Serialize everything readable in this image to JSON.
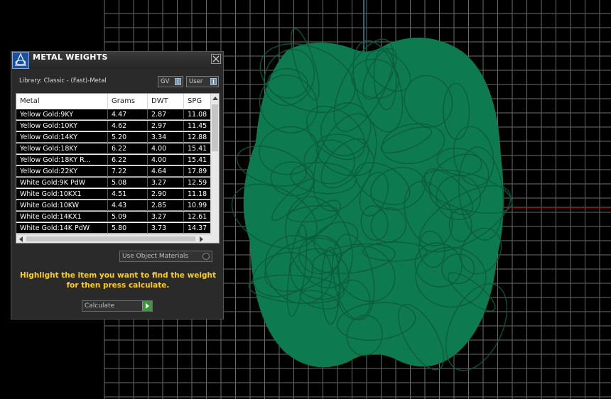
{
  "dialog": {
    "title": "METAL WEIGHTS",
    "library_label": "Library: Classic - (Fast)-Metal",
    "dropdown_gv": "GV",
    "dropdown_user": "User",
    "columns": [
      "Metal",
      "Grams",
      "DWT",
      "SPG"
    ],
    "rows": [
      {
        "metal": "Yellow Gold:9KY",
        "grams": "4.47",
        "dwt": "2.87",
        "spg": "11.08"
      },
      {
        "metal": "Yellow Gold:10KY",
        "grams": "4.62",
        "dwt": "2.97",
        "spg": "11.45"
      },
      {
        "metal": "Yellow Gold:14KY",
        "grams": "5.20",
        "dwt": "3.34",
        "spg": "12.88"
      },
      {
        "metal": "Yellow Gold:18KY",
        "grams": "6.22",
        "dwt": "4.00",
        "spg": "15.41"
      },
      {
        "metal": "Yellow Gold:18KY R...",
        "grams": "6.22",
        "dwt": "4.00",
        "spg": "15.41"
      },
      {
        "metal": "Yellow Gold:22KY",
        "grams": "7.22",
        "dwt": "4.64",
        "spg": "17.89"
      },
      {
        "metal": "White Gold:9K PdW",
        "grams": "5.08",
        "dwt": "3.27",
        "spg": "12.59"
      },
      {
        "metal": "White Gold:10KX1",
        "grams": "4.51",
        "dwt": "2.90",
        "spg": "11.18"
      },
      {
        "metal": "White Gold:10KW",
        "grams": "4.43",
        "dwt": "2.85",
        "spg": "10.99"
      },
      {
        "metal": "White Gold:14KX1",
        "grams": "5.09",
        "dwt": "3.27",
        "spg": "12.61"
      },
      {
        "metal": "White Gold:14K PdW",
        "grams": "5.80",
        "dwt": "3.73",
        "spg": "14.37"
      }
    ],
    "use_object_materials": "Use Object Materials",
    "instruction": "Highlight the item you want to find the weight for then press calculate.",
    "calculate_label": "Calculate"
  },
  "colors": {
    "model_green": "#0e7a50",
    "grid": "#6b6b6b",
    "axis_x": "#b01a1a",
    "axis_y": "#2a8ea0",
    "instruction_text": "#ffcc1a"
  }
}
